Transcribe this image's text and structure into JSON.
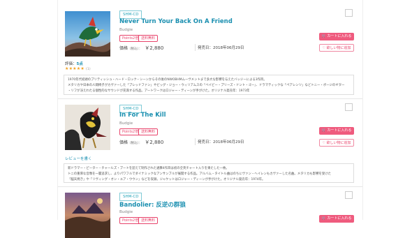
{
  "products": [
    {
      "tag": "SHM-CD",
      "title": "Never Turn Your Back On A Friend",
      "artist": "Budgie",
      "badges": [
        "Points2倍",
        "送料無料"
      ],
      "price_label": "価格",
      "tax_label": "（税込）：",
      "price": "￥2,880",
      "release": "発売日：2018年06月29日",
      "cart_label": "カートに入れる",
      "wish_label": "欲しい物に追加",
      "rating_label": "評価：",
      "rating_value": "5点",
      "stars": "★★★★★",
      "rating_count": "(1)",
      "desc_lines": [
        "1970年代初頭のブリティッシュ・ハード・ロック・シーンからその後のNWOBHMムーヴメントまで多大な影響を与えたバッジーによる3作目。",
        "メタリカや日本の人間椅子がカヴァーした「ブレッドファン」やビッグ・ジョー・ウィリアムスの「ベイビー・プリーズ・ドント・ゴー」、ドラマティックな「ペアレンツ」などトニー・ボージのギター",
        "・リフが冴えわたる個性的なサウンドが充満する作品。アートワークはロジャー・ディーンが手がけた。オリジナル発売年：1973年"
      ]
    },
    {
      "tag": "SHM-CD",
      "title": "In For The Kill",
      "artist": "Budgie",
      "badges": [
        "Points2倍",
        "送料無料"
      ],
      "price_label": "価格",
      "tax_label": "（税込）：",
      "price": "￥2,880",
      "release": "発売日：2018年06月29日",
      "cart_label": "カートに入れる",
      "wish_label": "欲しい物に追加",
      "review_link": "レビューを書く",
      "desc_lines": [
        "新ドラマー・ピーター・チャールズ・ブートを迎えて制作された通算4作目は初の全英チャート入りを果たした一枚。",
        "トニの重厚な音像を一層追求し、よりパワフルでダイナミックなアンサンブルが展開する作品。アルバム・タイトル曲はのちにヴァン・ヘイレンもカヴァーした名曲。メタリカも影響を受けた",
        "「脳天焼き」や「リヴィング・オン・ユア・ウウン」などを収録。ジャケットはロジャー・ディーンが手がけた。オリジナル発売年：1974年。"
      ]
    },
    {
      "tag": "SHM-CD",
      "title": "Bandolier: 反逆の群狼",
      "artist": "Budgie",
      "badges": [
        "Points2倍",
        "送料無料"
      ],
      "cart_label": "カートに入れる"
    }
  ],
  "colors": {
    "accent": "#ef5b7e",
    "link": "#1a8fb0",
    "tag": "#23a3b8",
    "star": "#f0a020"
  }
}
